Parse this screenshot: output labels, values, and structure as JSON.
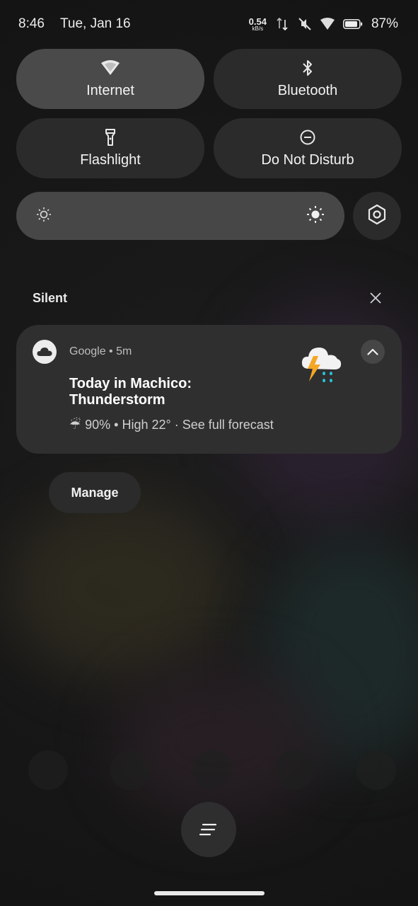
{
  "status_bar": {
    "time": "8:46",
    "date": "Tue, Jan 16",
    "net_speed_value": "0.54",
    "net_speed_unit": "kB/s",
    "battery": "87%",
    "icons": [
      "data-arrows-icon",
      "mute-icon",
      "wifi-icon",
      "battery-icon"
    ]
  },
  "quick_tiles": [
    {
      "label": "Internet",
      "icon": "wifi-icon",
      "active": true
    },
    {
      "label": "Bluetooth",
      "icon": "bluetooth-icon",
      "active": false
    },
    {
      "label": "Flashlight",
      "icon": "flashlight-icon",
      "active": false
    },
    {
      "label": "Do Not Disturb",
      "icon": "dnd-icon",
      "active": false
    }
  ],
  "brightness": {
    "level": 1.0
  },
  "silent_section": {
    "title": "Silent"
  },
  "notification": {
    "app_meta": "Google • 5m",
    "headline_line1": "Today in Machico:",
    "headline_line2": "Thunderstorm",
    "detail_umbrella": "☔",
    "detail": "90% • High 22° · See full forecast"
  },
  "manage_label": "Manage",
  "colors": {
    "panel_bg": "#161616",
    "tile_bg": "#2b2b2b",
    "tile_active_bg": "#4a4a4a",
    "lightning": "#f5a623",
    "rain": "#29c5e0"
  }
}
